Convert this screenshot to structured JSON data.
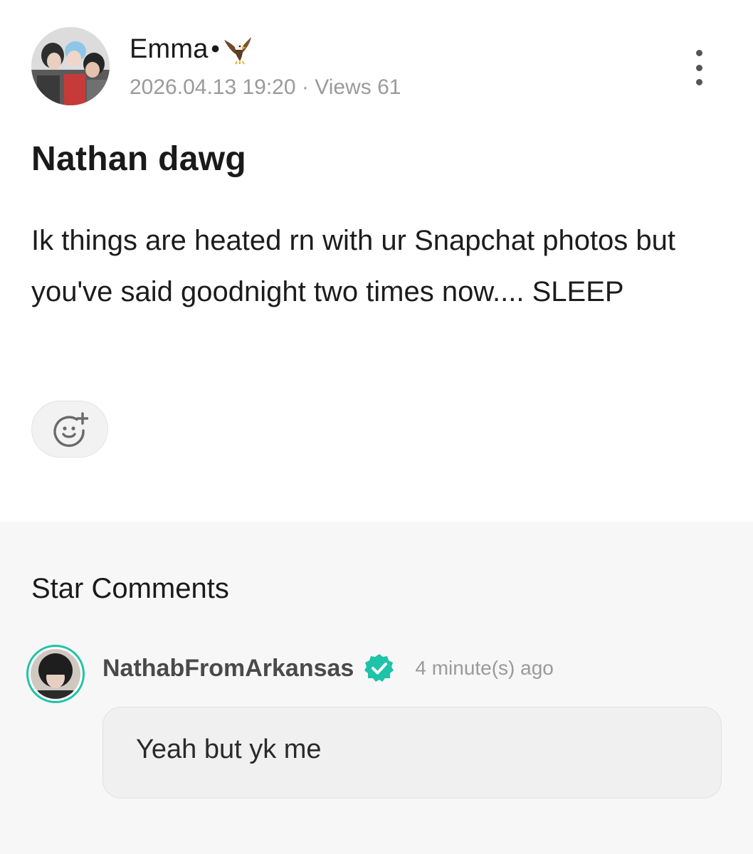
{
  "post": {
    "author": {
      "name": "Emma",
      "separator": "•",
      "badge_icon": "eagle-icon",
      "avatar": "group-photo-avatar"
    },
    "date": "2026.04.13 19:20",
    "meta_separator": "·",
    "views": "Views 61",
    "title": "Nathan dawg",
    "body": "Ik things are heated rn with ur Snapchat photos but you've said goodnight two times now.... SLEEP",
    "menu_icon": "more-vertical-icon",
    "reaction_icon": "add-reaction-icon"
  },
  "comments": {
    "section_title": "Star Comments",
    "items": [
      {
        "author": "NathabFromArkansas",
        "verified_icon": "verified-badge-icon",
        "time": "4 minute(s) ago",
        "text": "Yeah but yk me",
        "avatar": "user-photo-avatar"
      }
    ]
  },
  "colors": {
    "accent": "#1ec3a8",
    "muted_text": "#9a9a9a",
    "comments_bg": "#f7f7f7",
    "bubble_bg": "#f0f0f0"
  }
}
